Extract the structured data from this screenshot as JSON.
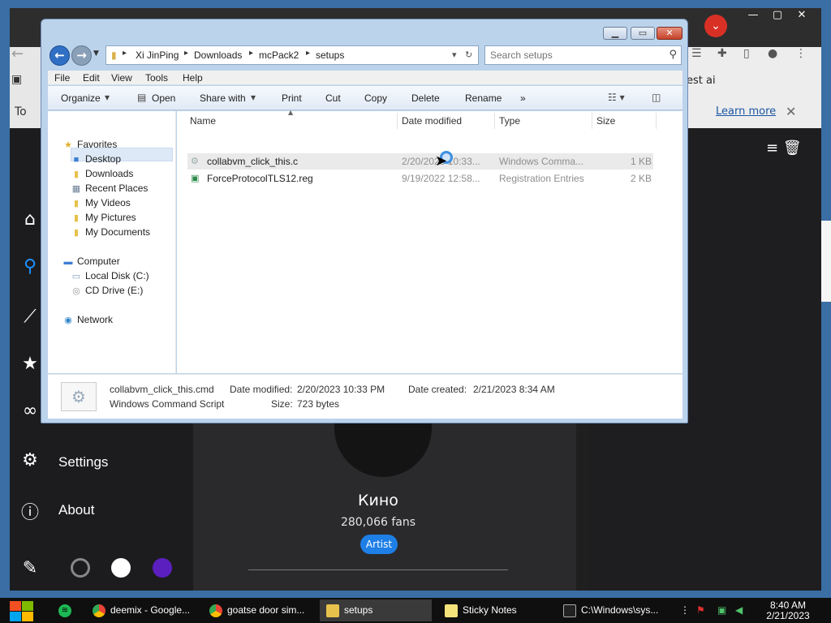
{
  "browser": {
    "banner_text_fragment": "est ai",
    "banner_left_fragment": "To",
    "learn_more": "Learn more",
    "accent_color": "#d93025"
  },
  "deemix": {
    "sidebar": [
      {
        "icon": "home-icon",
        "label": ""
      },
      {
        "icon": "search-icon",
        "label": ""
      },
      {
        "icon": "chart-icon",
        "label": ""
      },
      {
        "icon": "star-icon",
        "label": ""
      },
      {
        "icon": "link-icon",
        "label": ""
      },
      {
        "icon": "gear-icon",
        "label": "Settings"
      },
      {
        "icon": "info-icon",
        "label": "About"
      }
    ],
    "themes": [
      "#1c1c1e",
      "#ffffff",
      "#5b1fbf"
    ],
    "artist": {
      "name": "Кино",
      "fans": "280,066 fans",
      "badge": "Artist"
    }
  },
  "explorer": {
    "breadcrumb": [
      "Xi JinPing",
      "Downloads",
      "mcPack2",
      "setups"
    ],
    "search_placeholder": "Search setups",
    "menu": [
      "File",
      "Edit",
      "View",
      "Tools",
      "Help"
    ],
    "toolbar": [
      "Organize",
      "Open",
      "Share with",
      "Print",
      "Cut",
      "Copy",
      "Delete",
      "Rename"
    ],
    "toolbar_more": "»",
    "nav": {
      "favorites": "Favorites",
      "favorites_items": [
        "Desktop",
        "Downloads",
        "Recent Places",
        "My Videos",
        "My Pictures",
        "My Documents"
      ],
      "computer": "Computer",
      "computer_items": [
        "Local Disk (C:)",
        "CD Drive (E:)"
      ],
      "network": "Network"
    },
    "columns": [
      "Name",
      "Date modified",
      "Type",
      "Size"
    ],
    "files": [
      {
        "name": "collabvm_click_this.cmd",
        "date": "2/20/2023 10:33...",
        "type": "Windows Comma...",
        "size": "1 KB"
      },
      {
        "name": "ForceProtocolTLS12.reg",
        "date": "9/19/2022 12:58...",
        "type": "Registration Entries",
        "size": "2 KB"
      }
    ],
    "details": {
      "filename": "collabvm_click_this.cmd",
      "filetype": "Windows Command Script",
      "modified_label": "Date modified:",
      "modified_value": "2/20/2023 10:33 PM",
      "created_label": "Date created:",
      "created_value": "2/21/2023 8:34 AM",
      "size_label": "Size:",
      "size_value": "723 bytes"
    }
  },
  "taskbar": {
    "apps": [
      {
        "label": "deemix - Google...",
        "icon": "chrome-icon"
      },
      {
        "label": "goatse door sim...",
        "icon": "chrome-icon"
      },
      {
        "label": "setups",
        "icon": "folder-icon"
      },
      {
        "label": "Sticky Notes",
        "icon": "sticky-notes-icon"
      },
      {
        "label": "C:\\Windows\\sys...",
        "icon": "cmd-icon"
      }
    ],
    "time": "8:40 AM",
    "date": "2/21/2023"
  }
}
